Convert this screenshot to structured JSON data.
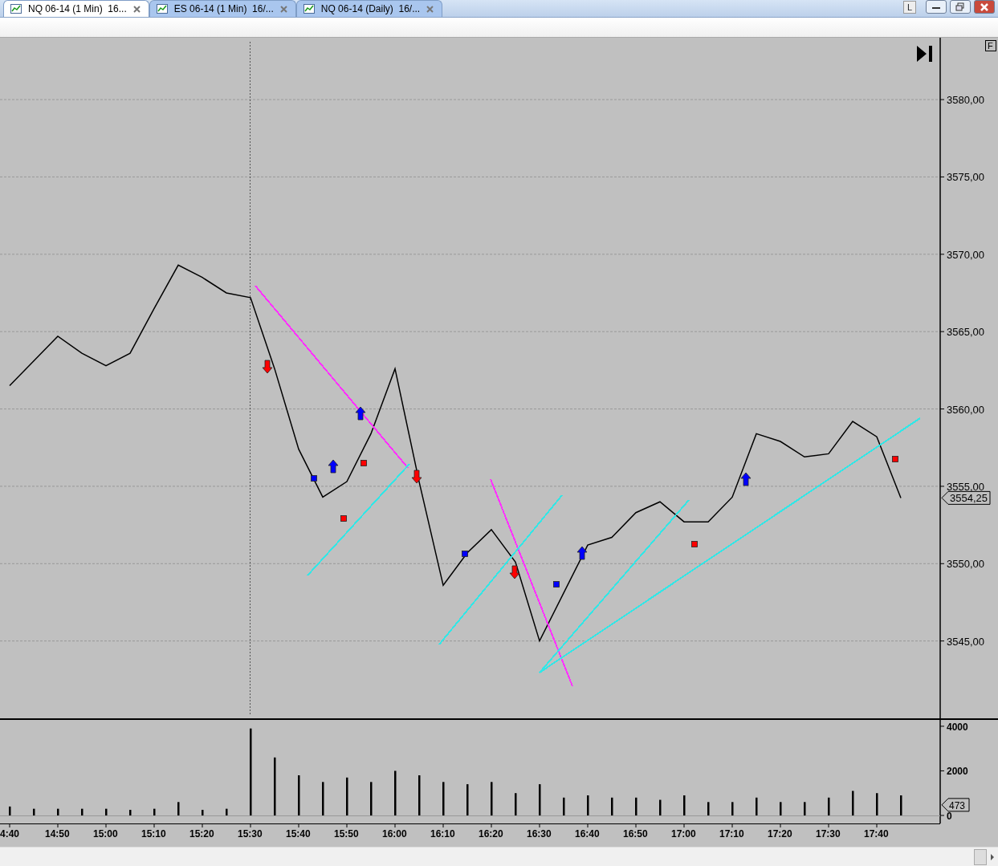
{
  "tabs": [
    {
      "label": "NQ 06-14 (1 Min)  16...",
      "selected": true
    },
    {
      "label": "ES 06-14 (1 Min)  16/...",
      "selected": false
    },
    {
      "label": "NQ 06-14 (Daily)  16/...",
      "selected": false
    }
  ],
  "window_buttons": {
    "layout_label": "L"
  },
  "price_panel": {
    "format_button": "F",
    "last_price": "3554,25",
    "chart_data": {
      "type": "line",
      "ylim": [
        3540,
        3584
      ],
      "yticks": [
        {
          "value": 3545,
          "label": "3545,00"
        },
        {
          "value": 3550,
          "label": "3550,00"
        },
        {
          "value": 3555,
          "label": "3555,00"
        },
        {
          "value": 3560,
          "label": "3560,00"
        },
        {
          "value": 3565,
          "label": "3565,00"
        },
        {
          "value": 3570,
          "label": "3570,00"
        },
        {
          "value": 3575,
          "label": "3575,00"
        },
        {
          "value": 3580,
          "label": "3580,00"
        }
      ],
      "grid": true,
      "categories": [
        null,
        null,
        null,
        null,
        null,
        null,
        null,
        null,
        null,
        null,
        null,
        null,
        null,
        null,
        null,
        null,
        null,
        null,
        null,
        null,
        null,
        null,
        null,
        null,
        null,
        null,
        null,
        null,
        null,
        null,
        null,
        null,
        null,
        null,
        null,
        null,
        null,
        null
      ],
      "series": [
        {
          "color": "#000000",
          "values": [
            3561.5,
            3563.1,
            3564.7,
            3563.6,
            3562.8,
            3563.6,
            3566.5,
            3569.3,
            3568.5,
            3567.5,
            3567.2,
            3562.6,
            3557.4,
            3554.3,
            3555.3,
            3558.4,
            3562.6,
            3555.3,
            3548.6,
            3550.7,
            3552.2,
            3550.1,
            3545.0,
            3548.1,
            3551.2,
            3551.7,
            3553.3,
            3554.0,
            3552.7,
            3552.7,
            3554.3,
            3558.4,
            3557.9,
            3556.9,
            3557.1,
            3559.2,
            3558.2,
            3554.25
          ]
        }
      ]
    },
    "trend_lines": [
      {
        "color": "#ff33ff"
      },
      {
        "color": "#33e6e6"
      },
      {
        "color": "#ff33ff"
      },
      {
        "color": "#33e6e6"
      },
      {
        "color": "#33e6e6"
      },
      {
        "color": "#33e6e6"
      }
    ],
    "signals": [
      {
        "kind": "arrow_down",
        "color": "#ff0000"
      },
      {
        "kind": "arrow_down",
        "color": "#ff0000"
      },
      {
        "kind": "arrow_down",
        "color": "#ff0000"
      },
      {
        "kind": "arrow_up",
        "color": "#0000ff"
      },
      {
        "kind": "arrow_up",
        "color": "#0000ff"
      },
      {
        "kind": "arrow_up",
        "color": "#0000ff"
      },
      {
        "kind": "arrow_up",
        "color": "#0000ff"
      },
      {
        "kind": "square",
        "color": "#0000ff"
      },
      {
        "kind": "square",
        "color": "#0000ff"
      },
      {
        "kind": "square",
        "color": "#0000ff"
      },
      {
        "kind": "square",
        "color": "#ff0000"
      },
      {
        "kind": "square",
        "color": "#ff0000"
      },
      {
        "kind": "square",
        "color": "#ff0000"
      },
      {
        "kind": "square",
        "color": "#ff0000"
      }
    ]
  },
  "volume_panel": {
    "last_value": "473",
    "chart_data": {
      "type": "bar",
      "ylim": [
        0,
        4320
      ],
      "yticks": [
        0,
        2000,
        4000
      ],
      "categories": [
        "4:40",
        null,
        "14:50",
        null,
        "15:00",
        null,
        "15:10",
        null,
        "15:20",
        null,
        "15:30",
        null,
        "15:40",
        null,
        "15:50",
        null,
        "16:00",
        null,
        "16:10",
        null,
        "16:20",
        null,
        "16:30",
        null,
        "16:40",
        null,
        "16:50",
        null,
        "17:00",
        null,
        "17:10",
        null,
        "17:20",
        null,
        "17:30",
        null,
        "17:40",
        null
      ],
      "series": [
        {
          "color": "#000000",
          "values": [
            400,
            300,
            300,
            300,
            300,
            250,
            300,
            600,
            250,
            300,
            3900,
            2600,
            1800,
            1500,
            1700,
            1500,
            2000,
            1800,
            1500,
            1400,
            1500,
            1000,
            1400,
            800,
            900,
            800,
            800,
            700,
            900,
            600,
            600,
            800,
            600,
            600,
            800,
            1100,
            1000,
            900
          ]
        }
      ]
    }
  }
}
